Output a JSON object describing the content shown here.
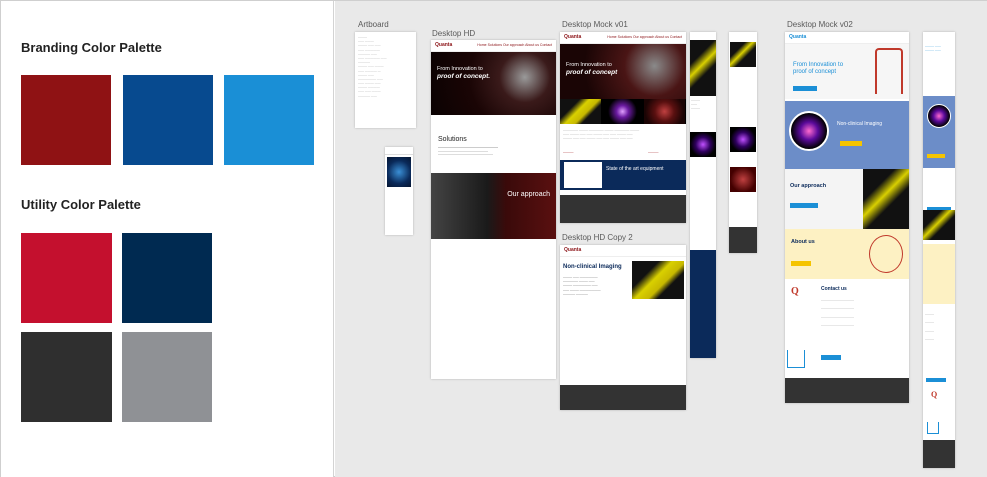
{
  "palettes": {
    "branding": {
      "title": "Branding Color Palette",
      "colors": [
        "#8f1214",
        "#074a8f",
        "#1a8fd6"
      ]
    },
    "utility": {
      "title": "Utility Color Palette",
      "colors": [
        "#c4102e",
        "#002a51",
        "#2f2f2f",
        "#8f9195"
      ]
    }
  },
  "artboards": {
    "artboard": {
      "label": "Artboard"
    },
    "desktop_hd": {
      "label": "Desktop HD",
      "logo": "Quanta",
      "nav": "Home   Solutions   Our approach   About us   Contact",
      "hero_line1": "From Innovation to",
      "hero_line2": "proof of concept.",
      "solutions": "Solutions",
      "approach": "Our approach"
    },
    "mock_v01": {
      "label": "Desktop Mock v01",
      "hero_line1": "From Innovation to",
      "hero_line2": "proof of concept",
      "state_of_art": "State of the art equipment"
    },
    "hd_copy2": {
      "label": "Desktop HD Copy 2",
      "nonclinical": "Non-clinical Imaging"
    },
    "mock_v02": {
      "label": "Desktop Mock v02",
      "hero_line1": "From Innovation to",
      "hero_line2": "proof of concept",
      "nonclinical": "Non-clinical Imaging",
      "approach": "Our approach",
      "about": "About us",
      "contact": "Contact us"
    }
  }
}
